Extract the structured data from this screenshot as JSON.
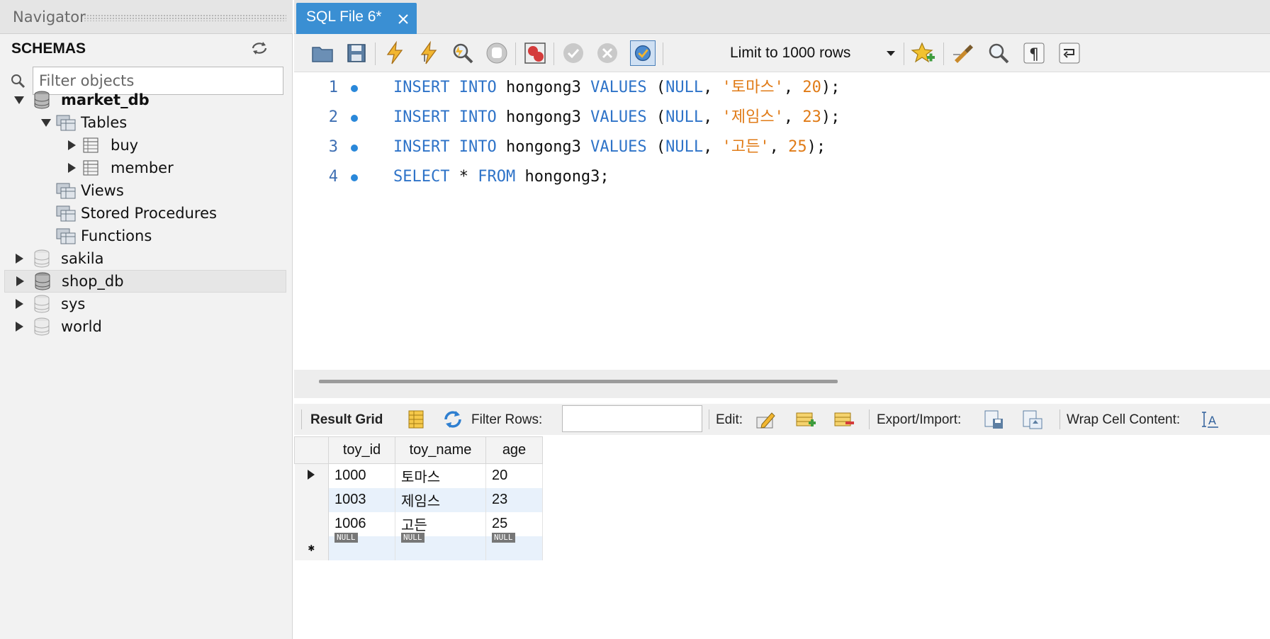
{
  "navigator": {
    "title": "Navigator",
    "schemas_label": "SCHEMAS",
    "filter_placeholder": "Filter objects",
    "schemas": [
      {
        "name": "market_db",
        "expanded": true,
        "children": [
          {
            "label": "Tables",
            "tables": [
              "buy",
              "member"
            ]
          },
          {
            "label": "Views"
          },
          {
            "label": "Stored Procedures"
          },
          {
            "label": "Functions"
          }
        ]
      },
      {
        "name": "sakila"
      },
      {
        "name": "shop_db",
        "selected": true
      },
      {
        "name": "sys"
      },
      {
        "name": "world"
      }
    ]
  },
  "editor_tab": {
    "label": "SQL File 6*"
  },
  "toolbar": {
    "limit_label": "Limit to 1000 rows"
  },
  "code_lines": [
    {
      "num": "1",
      "tokens": [
        [
          "kw",
          "INSERT"
        ],
        [
          "pl",
          " "
        ],
        [
          "kw",
          "INTO"
        ],
        [
          "pl",
          " hongong3 "
        ],
        [
          "kw",
          "VALUES"
        ],
        [
          "pl",
          " ("
        ],
        [
          "kw",
          "NULL"
        ],
        [
          "pl",
          ", "
        ],
        [
          "str",
          "'토마스'"
        ],
        [
          "pl",
          ", "
        ],
        [
          "num",
          "20"
        ],
        [
          "pl",
          ");"
        ]
      ]
    },
    {
      "num": "2",
      "tokens": [
        [
          "kw",
          "INSERT"
        ],
        [
          "pl",
          " "
        ],
        [
          "kw",
          "INTO"
        ],
        [
          "pl",
          " hongong3 "
        ],
        [
          "kw",
          "VALUES"
        ],
        [
          "pl",
          " ("
        ],
        [
          "kw",
          "NULL"
        ],
        [
          "pl",
          ", "
        ],
        [
          "str",
          "'제임스'"
        ],
        [
          "pl",
          ", "
        ],
        [
          "num",
          "23"
        ],
        [
          "pl",
          ");"
        ]
      ]
    },
    {
      "num": "3",
      "tokens": [
        [
          "kw",
          "INSERT"
        ],
        [
          "pl",
          " "
        ],
        [
          "kw",
          "INTO"
        ],
        [
          "pl",
          " hongong3 "
        ],
        [
          "kw",
          "VALUES"
        ],
        [
          "pl",
          " ("
        ],
        [
          "kw",
          "NULL"
        ],
        [
          "pl",
          ", "
        ],
        [
          "str",
          "'고든'"
        ],
        [
          "pl",
          ", "
        ],
        [
          "num",
          "25"
        ],
        [
          "pl",
          ");"
        ]
      ]
    },
    {
      "num": "4",
      "tokens": [
        [
          "kw",
          "SELECT"
        ],
        [
          "pl",
          " * "
        ],
        [
          "kw",
          "FROM"
        ],
        [
          "pl",
          " hongong3;"
        ]
      ]
    }
  ],
  "result_toolbar": {
    "result_grid": "Result Grid",
    "filter_rows": "Filter Rows:",
    "edit": "Edit:",
    "export_import": "Export/Import:",
    "wrap_cell": "Wrap Cell Content:"
  },
  "grid": {
    "columns": [
      "toy_id",
      "toy_name",
      "age"
    ],
    "rows": [
      [
        "1000",
        "토마스",
        "20"
      ],
      [
        "1003",
        "제임스",
        "23"
      ],
      [
        "1006",
        "고든",
        "25"
      ]
    ],
    "null_label": "NULL"
  },
  "colors": {
    "accent": "#3a8fd3",
    "keyword": "#2e73c8",
    "string": "#e07b17",
    "line_number": "#3e6fb3"
  }
}
